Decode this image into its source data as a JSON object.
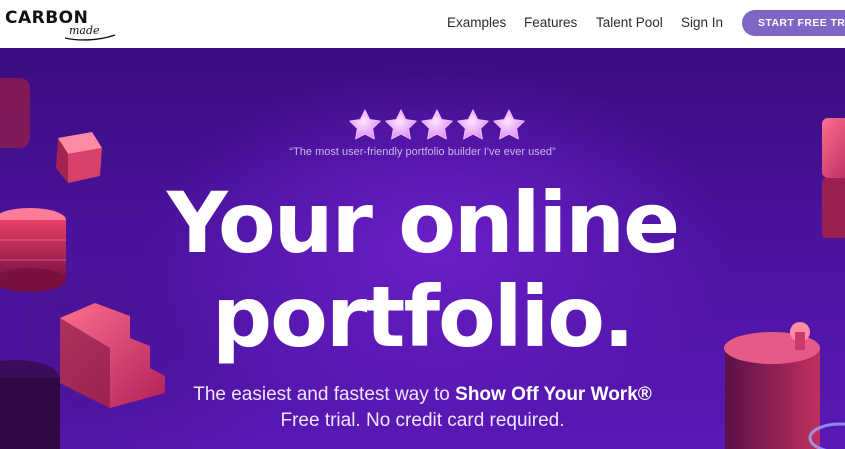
{
  "header": {
    "logo_main": "CARBON",
    "logo_sub": "made",
    "nav": [
      "Examples",
      "Features",
      "Talent Pool",
      "Sign In"
    ],
    "cta_label": "START FREE TRIAL",
    "cta_color": "#7e65c6"
  },
  "hero": {
    "rating_stars": 5,
    "star_color": "#f3b8ff",
    "quote": "“The most user-friendly portfolio builder I've ever used”",
    "headline_line1": "Your online",
    "headline_line2": "portfolio.",
    "subtitle_lead": "The easiest and fastest way to ",
    "subtitle_emphasis": "Show Off Your Work®",
    "subtitle_line2": "Free trial. No credit card required."
  }
}
